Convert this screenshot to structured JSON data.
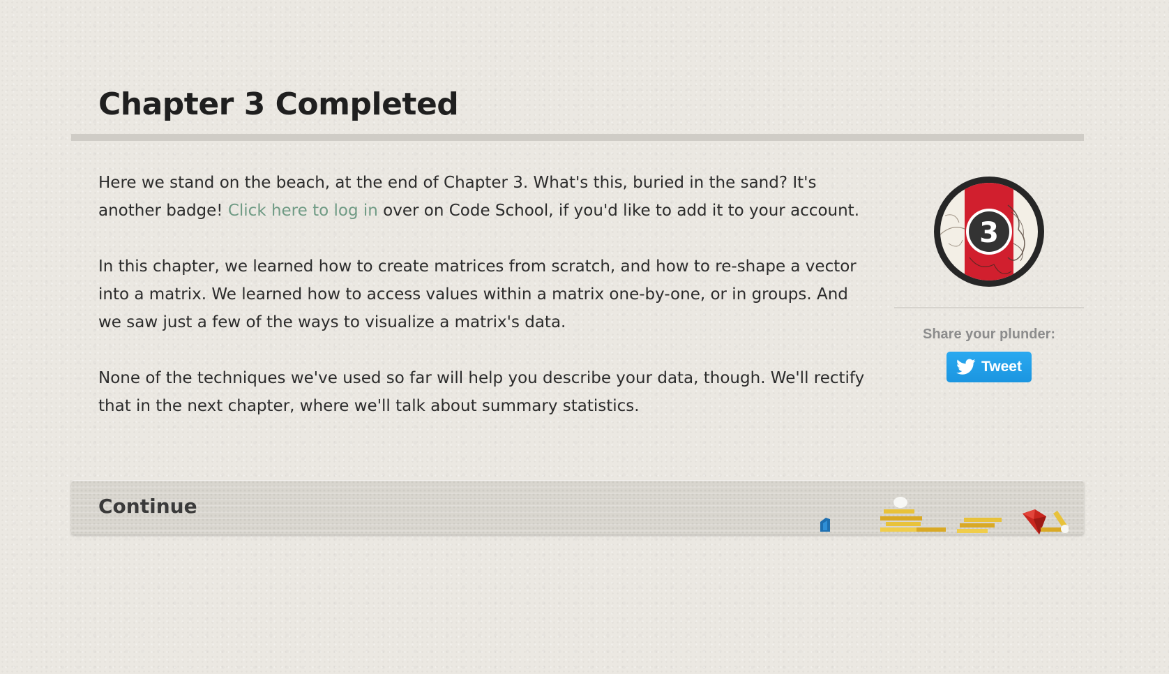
{
  "page": {
    "title": "Chapter 3 Completed"
  },
  "content": {
    "p1_before_link": "Here we stand on the beach, at the end of Chapter 3. What's this, buried in the sand? It's another badge! ",
    "p1_link": "Click here to log in",
    "p1_after_link": " over on Code School, if you'd like to add it to your account.",
    "p2": "In this chapter, we learned how to create matrices from scratch, and how to re-shape a vector into a matrix. We learned how to access values within a matrix one-by-one, or in groups. And we saw just a few of the ways to visualize a matrix's data.",
    "p3": "None of the techniques we've used so far will help you describe your data, though. We'll rectify that in the next chapter, where we'll talk about summary statistics."
  },
  "sidebar": {
    "badge_number": "3",
    "share_label": "Share your plunder:",
    "tweet_label": "Tweet"
  },
  "footer": {
    "continue_label": "Continue"
  },
  "colors": {
    "link": "#6f9a84",
    "tweet_button": "#1da1f2",
    "badge_red": "#d11f2e",
    "badge_ring": "#262626",
    "gold": "#e8c23a",
    "ruby": "#c8261e",
    "blue_gem": "#1e6fb0"
  },
  "icons": {
    "badge": "chapter-badge-icon",
    "twitter": "twitter-bird-icon",
    "treasure": "treasure-pile-icon"
  }
}
